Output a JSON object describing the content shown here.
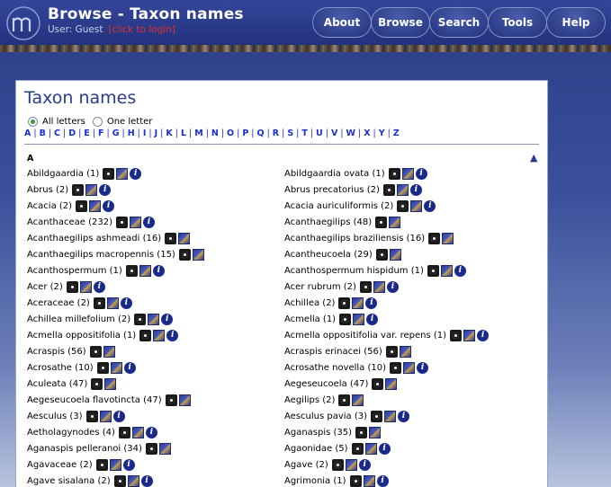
{
  "header": {
    "title": "Browse - Taxon names",
    "user_label": "User: Guest",
    "login_link": "[click to login]",
    "nav": [
      "About",
      "Browse",
      "Search",
      "Tools",
      "Help"
    ]
  },
  "page": {
    "title": "Taxon names",
    "radio_all": "All letters",
    "radio_one": "One letter",
    "selected_radio": "All letters",
    "letters": [
      "A",
      "B",
      "C",
      "D",
      "E",
      "F",
      "G",
      "H",
      "I",
      "J",
      "K",
      "L",
      "M",
      "N",
      "O",
      "P",
      "Q",
      "R",
      "S",
      "T",
      "U",
      "V",
      "W",
      "X",
      "Y",
      "Z"
    ],
    "section_letter": "A",
    "left_column": [
      {
        "name": "Abildgaardia (1)",
        "icons": [
          "camera-icon",
          "map-icon",
          "info-icon"
        ]
      },
      {
        "name": "Abrus (2)",
        "icons": [
          "camera-icon",
          "map-icon",
          "info-icon"
        ]
      },
      {
        "name": "Acacia (2)",
        "icons": [
          "camera-icon",
          "map-icon",
          "info-icon"
        ]
      },
      {
        "name": "Acanthaceae (232)",
        "icons": [
          "camera-icon",
          "map-icon",
          "info-icon"
        ]
      },
      {
        "name": "Acanthaegilips ashmeadi (16)",
        "icons": [
          "camera-icon",
          "map-icon"
        ]
      },
      {
        "name": "Acanthaegilips macropennis (15)",
        "icons": [
          "camera-icon",
          "map-icon"
        ]
      },
      {
        "name": "Acanthospermum (1)",
        "icons": [
          "camera-icon",
          "map-icon",
          "info-icon"
        ]
      },
      {
        "name": "Acer (2)",
        "icons": [
          "camera-icon",
          "map-icon",
          "info-icon"
        ]
      },
      {
        "name": "Aceraceae (2)",
        "icons": [
          "camera-icon",
          "map-icon",
          "info-icon"
        ]
      },
      {
        "name": "Achillea millefolium (2)",
        "icons": [
          "camera-icon",
          "map-icon",
          "info-icon"
        ]
      },
      {
        "name": "Acmella oppositifolia (1)",
        "icons": [
          "camera-icon",
          "map-icon",
          "info-icon"
        ]
      },
      {
        "name": "Acraspis (56)",
        "icons": [
          "camera-icon",
          "map-icon"
        ]
      },
      {
        "name": "Acrosathe (10)",
        "icons": [
          "camera-icon",
          "map-icon",
          "info-icon"
        ]
      },
      {
        "name": "Aculeata (47)",
        "icons": [
          "camera-icon",
          "map-icon"
        ]
      },
      {
        "name": "Aegeseucoela flavotincta (47)",
        "icons": [
          "camera-icon",
          "map-icon"
        ]
      },
      {
        "name": "Aesculus (3)",
        "icons": [
          "camera-icon",
          "map-icon",
          "info-icon"
        ]
      },
      {
        "name": "Aetholagynodes (4)",
        "icons": [
          "camera-icon",
          "map-icon",
          "info-icon"
        ]
      },
      {
        "name": "Aganaspis pelleranoi (34)",
        "icons": [
          "camera-icon",
          "map-icon"
        ]
      },
      {
        "name": "Agavaceae (2)",
        "icons": [
          "camera-icon",
          "map-icon",
          "info-icon"
        ]
      },
      {
        "name": "Agave sisalana (2)",
        "icons": [
          "camera-icon",
          "map-icon",
          "info-icon"
        ]
      }
    ],
    "right_column": [
      {
        "name": "Abildgaardia ovata (1)",
        "icons": [
          "camera-icon",
          "map-icon",
          "info-icon"
        ]
      },
      {
        "name": "Abrus precatorius (2)",
        "icons": [
          "camera-icon",
          "map-icon",
          "info-icon"
        ]
      },
      {
        "name": "Acacia auriculiformis (2)",
        "icons": [
          "camera-icon",
          "map-icon",
          "info-icon"
        ]
      },
      {
        "name": "Acanthaegilips (48)",
        "icons": [
          "camera-icon",
          "map-icon"
        ]
      },
      {
        "name": "Acanthaegilips braziliensis (16)",
        "icons": [
          "camera-icon",
          "map-icon"
        ]
      },
      {
        "name": "Acantheucoela (29)",
        "icons": [
          "camera-icon",
          "map-icon"
        ]
      },
      {
        "name": "Acanthospermum hispidum (1)",
        "icons": [
          "camera-icon",
          "map-icon",
          "info-icon"
        ]
      },
      {
        "name": "Acer rubrum (2)",
        "icons": [
          "camera-icon",
          "map-icon",
          "info-icon"
        ]
      },
      {
        "name": "Achillea (2)",
        "icons": [
          "camera-icon",
          "map-icon",
          "info-icon"
        ]
      },
      {
        "name": "Acmella (1)",
        "icons": [
          "camera-icon",
          "map-icon",
          "info-icon"
        ]
      },
      {
        "name": "Acmella oppositifolia var. repens (1)",
        "icons": [
          "camera-icon",
          "map-icon",
          "info-icon"
        ]
      },
      {
        "name": "Acraspis erinacei (56)",
        "icons": [
          "camera-icon",
          "map-icon"
        ]
      },
      {
        "name": "Acrosathe novella (10)",
        "icons": [
          "camera-icon",
          "map-icon",
          "info-icon"
        ]
      },
      {
        "name": "Aegeseucoela (47)",
        "icons": [
          "camera-icon",
          "map-icon"
        ]
      },
      {
        "name": "Aegilips (2)",
        "icons": [
          "camera-icon",
          "map-icon"
        ]
      },
      {
        "name": "Aesculus pavia (3)",
        "icons": [
          "camera-icon",
          "map-icon",
          "info-icon"
        ]
      },
      {
        "name": "Aganaspis (35)",
        "icons": [
          "camera-icon",
          "map-icon"
        ]
      },
      {
        "name": "Agaonidae (5)",
        "icons": [
          "camera-icon",
          "map-icon",
          "info-icon"
        ]
      },
      {
        "name": "Agave (2)",
        "icons": [
          "camera-icon",
          "map-icon",
          "info-icon"
        ]
      },
      {
        "name": "Agrimonia (1)",
        "icons": [
          "camera-icon",
          "map-icon",
          "info-icon"
        ]
      }
    ]
  },
  "colors": {
    "header_bg": "#22327e",
    "link_blue": "#1a2ec8",
    "login_red": "#e03030",
    "title_blue": "#2a3c8a"
  }
}
